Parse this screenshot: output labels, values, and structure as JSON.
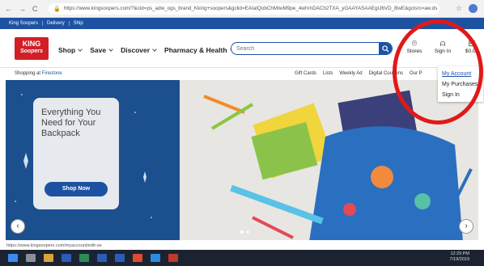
{
  "browser": {
    "url": "https://www.kingsoopers.com/?&cid=ps_adw_ogs_brand_Kking+soopers&gclid=EAIaIQobChMIwM9pe_4wIVnDACh2TXA_yGAAYASAAEgIJ6VD_BwE&gclsrc=aw.ds",
    "back": "←",
    "forward": "→",
    "reload": "C",
    "star": "☆"
  },
  "utility": [
    "King Soopers",
    "Delivery",
    "Ship"
  ],
  "logo": {
    "line1": "KING",
    "line2": "Soopers"
  },
  "menu": [
    "Shop",
    "Save",
    "Discover",
    "Pharmacy & Health"
  ],
  "search": {
    "placeholder": "Search"
  },
  "header_icons": {
    "stores": "Stores",
    "signin": "Sign In",
    "cart": "$0.00"
  },
  "store_bar": {
    "prefix": "Shopping at",
    "store": "Firestone"
  },
  "links": [
    "Gift Cards",
    "Lists",
    "Weekly Ad",
    "Digital Coupons",
    "Our P"
  ],
  "dropdown": [
    "My Account",
    "My Purchases",
    "Sign In"
  ],
  "hero": {
    "headline": "Everything You Need for Your Backpack",
    "cta": "Shop Now"
  },
  "status_url": "https://www.kingsoopers.com/myaccount/edit-oe",
  "clock": {
    "time": "12:29 PM",
    "date": "7/19/2019"
  },
  "colors": {
    "brand_blue": "#1d52a3",
    "king_red": "#d21f26",
    "annotation_red": "#e01919"
  }
}
